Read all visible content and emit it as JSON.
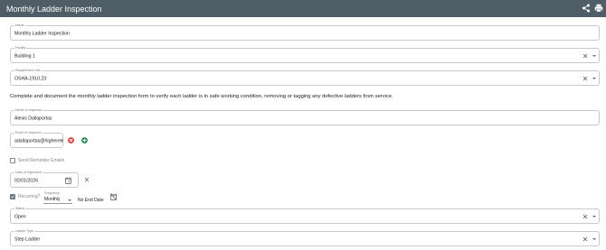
{
  "header": {
    "title": "Monthly Ladder Inspection"
  },
  "form": {
    "name": {
      "label": "Name",
      "value": "Monthly Ladder Inspection"
    },
    "facility": {
      "label": "Facility",
      "value": "Building 1"
    },
    "requirement": {
      "label": "Requirement List",
      "value": "OSHA-1910.23"
    },
    "description": "Complete and document the monthly ladder inspection form to verify each ladder is in safe working condition, removing or tagging any defective ladders from service.",
    "inspector_name": {
      "label": "Name of Inspector",
      "value": "Alexis Dallaportas"
    },
    "inspector_email": {
      "label": "Email of Inspector",
      "value": "adallaportas@higherele"
    },
    "send_reminder": {
      "label": "Send Reminder Emails",
      "checked": false
    },
    "date": {
      "label": "Date of Inspection",
      "value": "02/01/2026"
    },
    "recurring": {
      "label": "Recurring?",
      "checked": true
    },
    "frequency": {
      "label": "Frequency",
      "value": "Monthly"
    },
    "end_date": "No End Date",
    "status": {
      "label": "Status",
      "value": "Open"
    },
    "ladder_type": {
      "label": "Ladder Type",
      "value": "Step Ladder"
    }
  },
  "colors": {
    "header_bg": "#4f5d66",
    "remove_red": "#d63a3a",
    "add_green": "#2e8b57"
  }
}
